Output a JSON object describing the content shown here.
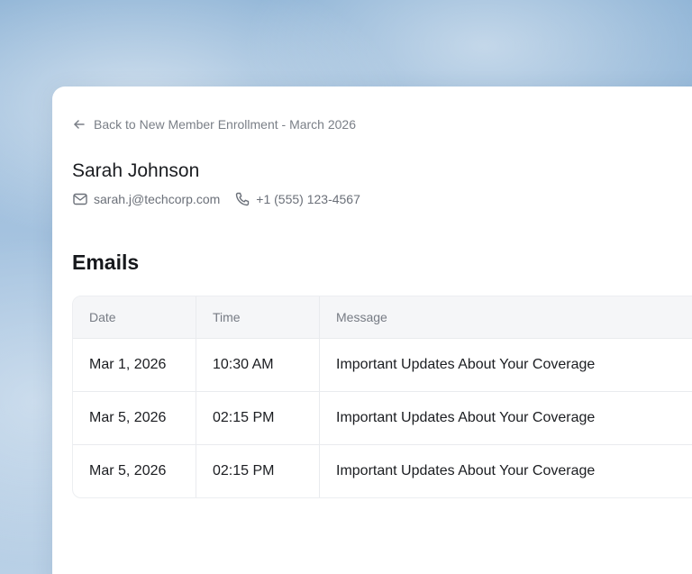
{
  "back_link": {
    "label": "Back to New Member Enrollment - March 2026",
    "icon": "arrow-left-icon"
  },
  "member": {
    "name": "Sarah Johnson",
    "email": "sarah.j@techcorp.com",
    "phone": "+1 (555) 123-4567",
    "email_icon": "mail-icon",
    "phone_icon": "phone-icon"
  },
  "emails_section": {
    "title": "Emails",
    "columns": [
      "Date",
      "Time",
      "Message"
    ],
    "rows": [
      {
        "date": "Mar 1, 2026",
        "time": "10:30 AM",
        "message": "Important Updates About Your Coverage"
      },
      {
        "date": "Mar 5, 2026",
        "time": "02:15 PM",
        "message": "Important Updates About Your Coverage"
      },
      {
        "date": "Mar 5, 2026",
        "time": "02:15 PM",
        "message": "Important Updates About Your Coverage"
      }
    ]
  },
  "colors": {
    "text_primary": "#1b1d21",
    "text_muted": "#7a7f87",
    "table_header_bg": "#f5f6f8",
    "border": "#e9ebee"
  }
}
